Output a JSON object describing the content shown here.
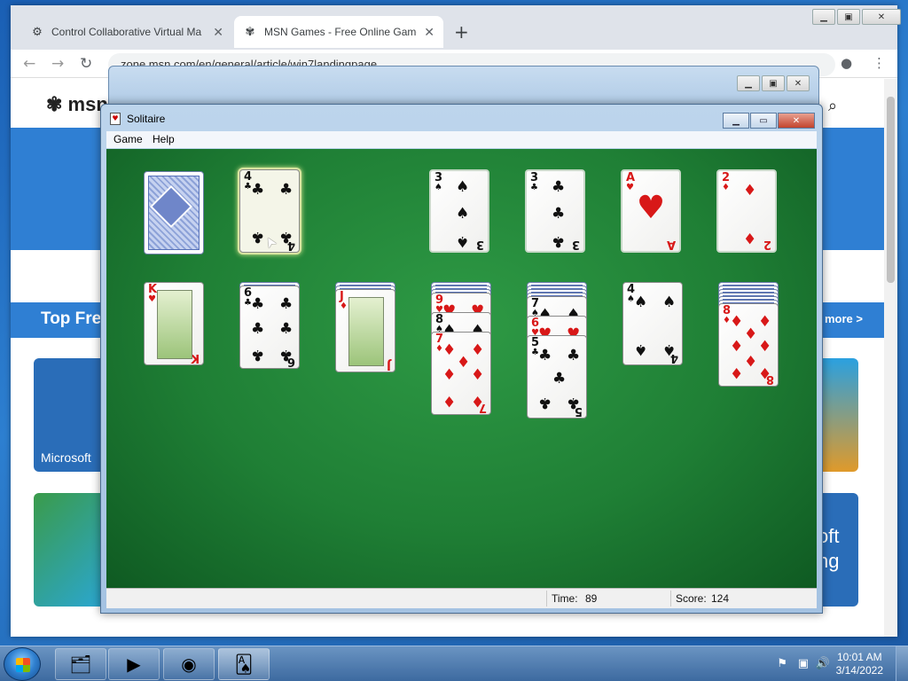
{
  "browser": {
    "tabs": [
      {
        "title": "Control Collaborative Virtual Ma",
        "icon": "server-icon",
        "active": false
      },
      {
        "title": "MSN Games - Free Online Games",
        "icon": "msn-butterfly-icon",
        "active": true
      }
    ],
    "address": "zone.msn.com/en/general/article/win7landingpage",
    "new_tab_symbol": "+"
  },
  "msn_page": {
    "logo_text": "msn",
    "section_title": "Top Fre",
    "more_link": "more >",
    "tile_captions": [
      "Microsoft",
      "oft",
      "ng"
    ]
  },
  "solitaire": {
    "window_title": "Solitaire",
    "menu": [
      "Game",
      "Help"
    ],
    "status": {
      "time_label": "Time:",
      "time_value": "89",
      "score_label": "Score:",
      "score_value": "124"
    },
    "stock": {
      "face_down": true
    },
    "waste": {
      "rank": "4",
      "suit": "♣",
      "color": "black",
      "selected": true
    },
    "foundations": [
      {
        "rank": "3",
        "suit": "♠",
        "color": "black"
      },
      {
        "rank": "3",
        "suit": "♣",
        "color": "black"
      },
      {
        "rank": "A",
        "suit": "♥",
        "color": "red"
      },
      {
        "rank": "2",
        "suit": "♦",
        "color": "red"
      }
    ],
    "tableau": [
      {
        "hidden": 0,
        "cards": [
          {
            "rank": "K",
            "suit": "♥",
            "color": "red"
          }
        ]
      },
      {
        "hidden": 1,
        "cards": [
          {
            "rank": "6",
            "suit": "♣",
            "color": "black"
          }
        ]
      },
      {
        "hidden": 2,
        "cards": [
          {
            "rank": "J",
            "suit": "♦",
            "color": "red"
          }
        ]
      },
      {
        "hidden": 3,
        "cards": [
          {
            "rank": "9",
            "suit": "♥",
            "color": "red"
          },
          {
            "rank": "8",
            "suit": "♠",
            "color": "black"
          },
          {
            "rank": "7",
            "suit": "♦",
            "color": "red"
          }
        ]
      },
      {
        "hidden": 4,
        "cards": [
          {
            "rank": "7",
            "suit": "♠",
            "color": "black"
          },
          {
            "rank": "6",
            "suit": "♥",
            "color": "red"
          },
          {
            "rank": "5",
            "suit": "♣",
            "color": "black"
          }
        ]
      },
      {
        "hidden": 0,
        "cards": [
          {
            "rank": "4",
            "suit": "♠",
            "color": "black"
          }
        ]
      },
      {
        "hidden": 6,
        "cards": [
          {
            "rank": "8",
            "suit": "♦",
            "color": "red"
          }
        ]
      }
    ]
  },
  "taskbar": {
    "clock_time": "10:01 AM",
    "clock_date": "3/14/2022",
    "pinned": [
      "explorer-icon",
      "media-player-icon",
      "chrome-icon",
      "solitaire-icon"
    ]
  },
  "colors": {
    "felt": "#1f7f35",
    "card_red": "#d81818",
    "card_black": "#111111",
    "accent": "#2f7fd3"
  }
}
